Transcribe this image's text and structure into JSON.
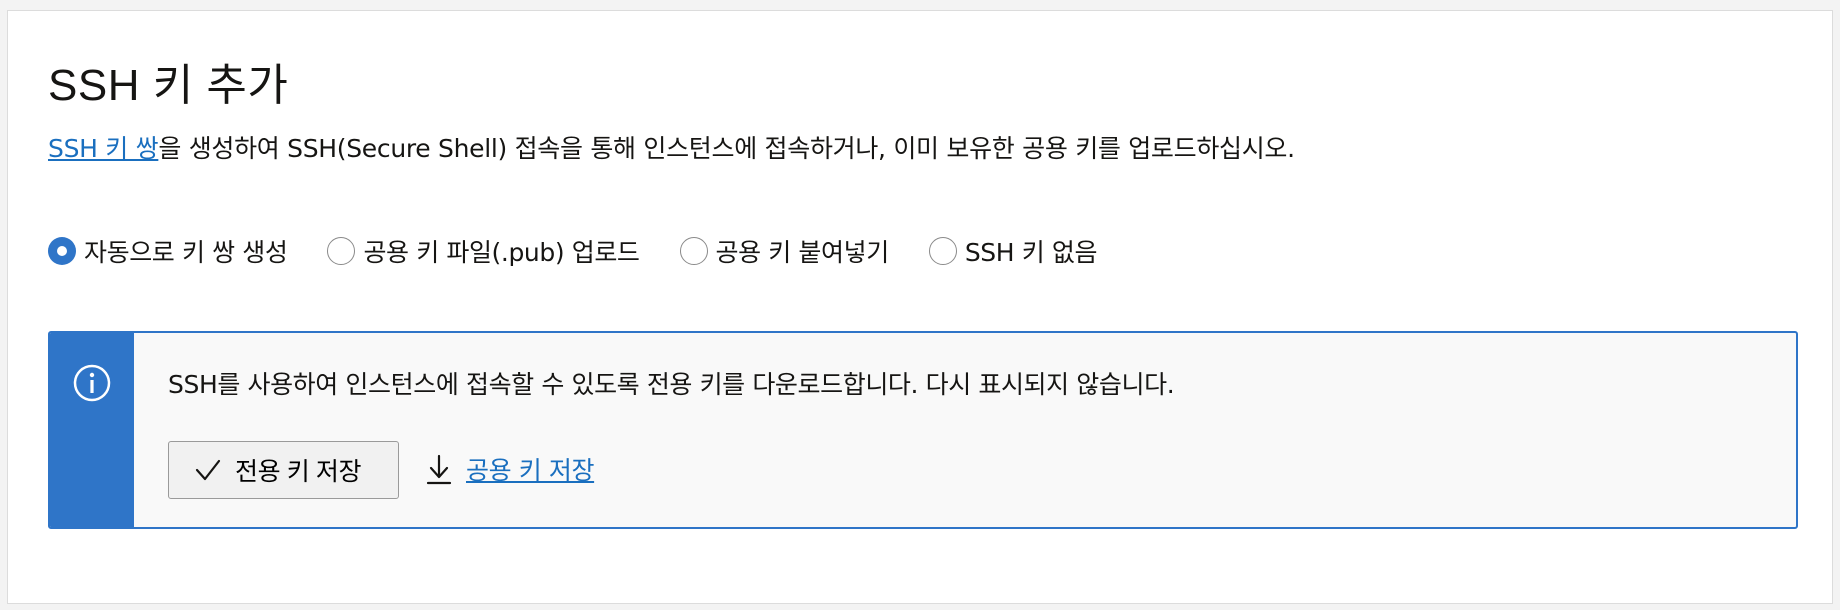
{
  "section": {
    "title": "SSH 키 추가",
    "description_link": "SSH 키 쌍",
    "description_rest": "을 생성하여 SSH(Secure Shell) 접속을 통해 인스턴스에 접속하거나, 이미 보유한 공용 키를 업로드하십시오."
  },
  "options": [
    {
      "label": "자동으로 키 쌍 생성",
      "checked": true
    },
    {
      "label": "공용 키 파일(.pub) 업로드",
      "checked": false
    },
    {
      "label": "공용 키 붙여넣기",
      "checked": false
    },
    {
      "label": "SSH 키 없음",
      "checked": false
    }
  ],
  "info": {
    "icon": "info-icon",
    "message": "SSH를 사용하여 인스턴스에 접속할 수 있도록 전용 키를 다운로드합니다. 다시 표시되지 않습니다.",
    "save_private_label": "전용 키 저장",
    "save_public_label": "공용 키 저장"
  },
  "colors": {
    "accent": "#2f75c8",
    "link": "#1a6fbf"
  }
}
